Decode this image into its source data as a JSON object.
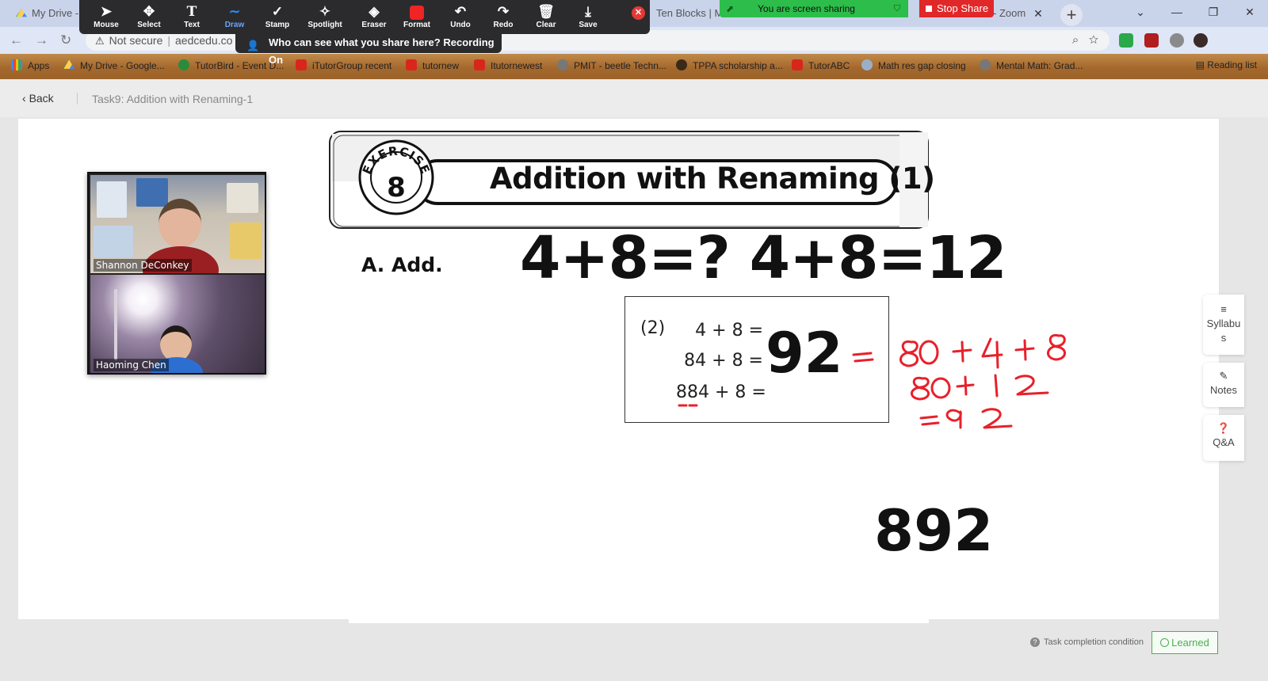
{
  "browser": {
    "tabs": [
      {
        "title": "My Drive -"
      },
      {
        "title": "Ten Blocks | Ma"
      },
      {
        "title": "- Zoom"
      }
    ],
    "new_tab_symbol": "+",
    "address": {
      "security": "Not secure",
      "url": "aedcedu.co"
    },
    "bookmarks": [
      {
        "label": "Apps",
        "icon": "apps-grid-icon"
      },
      {
        "label": "My Drive - Google...",
        "icon": "drive-icon"
      },
      {
        "label": "TutorBird - Event D...",
        "icon": "tutorbird-icon"
      },
      {
        "label": "iTutorGroup recent",
        "icon": "itutor-icon"
      },
      {
        "label": "tutornew",
        "icon": "itutor-icon"
      },
      {
        "label": "Itutornewest",
        "icon": "itutor-icon"
      },
      {
        "label": "PMIT - beetle Techn...",
        "icon": "pmit-icon"
      },
      {
        "label": "TPPA scholarship a...",
        "icon": "tppa-icon"
      },
      {
        "label": "TutorABC",
        "icon": "itutor-icon"
      },
      {
        "label": "Math res gap closing",
        "icon": "globe-icon"
      },
      {
        "label": "Mental Math: Grad...",
        "icon": "pmit-icon"
      }
    ],
    "reading_list": "Reading list"
  },
  "zoom": {
    "tools": [
      {
        "label": "Mouse",
        "icon": "cursor-icon"
      },
      {
        "label": "Select",
        "icon": "move-icon"
      },
      {
        "label": "Text",
        "icon": "text-icon"
      },
      {
        "label": "Draw",
        "icon": "draw-icon"
      },
      {
        "label": "Stamp",
        "icon": "stamp-icon"
      },
      {
        "label": "Spotlight",
        "icon": "spotlight-icon"
      },
      {
        "label": "Eraser",
        "icon": "eraser-icon"
      },
      {
        "label": "Format",
        "icon": "format-swatch-icon"
      },
      {
        "label": "Undo",
        "icon": "undo-icon"
      },
      {
        "label": "Redo",
        "icon": "redo-icon"
      },
      {
        "label": "Clear",
        "icon": "trash-icon"
      },
      {
        "label": "Save",
        "icon": "save-icon"
      }
    ],
    "active_tool": "Draw",
    "recording_banner": "Who can see what you share here? Recording On",
    "sharing_status": "You are screen sharing",
    "stop_share": "Stop Share",
    "format_color": "#f02424",
    "participants": [
      {
        "name": "Shannon DeConkey"
      },
      {
        "name": "Haoming Chen"
      }
    ]
  },
  "page": {
    "back": "Back",
    "task_title": "Task9:  Addition with Renaming-1",
    "task_condition": "Task completion condition",
    "learned": "Learned"
  },
  "worksheet": {
    "exercise_label": "EXERCISE",
    "exercise_number": "8",
    "title": "Addition with Renaming (1)",
    "section": "A.  Add.",
    "typed_equation": "4+8=? 4+8=12",
    "problem_number": "(2)",
    "problem_lines": [
      "4 + 8 =",
      "84 + 8 =",
      "884 + 8 ="
    ],
    "answer_typed": "92",
    "answer_typed_2": "892",
    "handwritten": {
      "line1": "= 80 + 4 + 8",
      "line2": "80 + 12",
      "line3": "= 92",
      "ink_color": "#e8202a"
    }
  },
  "rail": {
    "syllabus": "Syllabus",
    "notes": "Notes",
    "qa": "Q&A"
  }
}
